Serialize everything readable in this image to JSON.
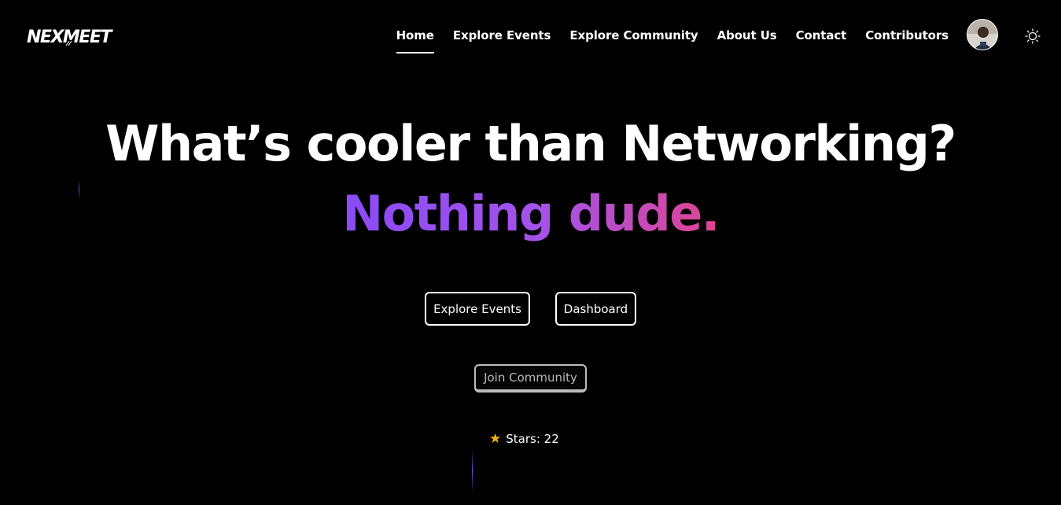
{
  "navbar": {
    "logo_text": "NEXMEET",
    "links": [
      {
        "label": "Home",
        "active": true
      },
      {
        "label": "Explore Events",
        "active": false
      },
      {
        "label": "Explore Community",
        "active": false
      },
      {
        "label": "About Us",
        "active": false
      },
      {
        "label": "Contact",
        "active": false
      },
      {
        "label": "Contributors",
        "active": false
      }
    ],
    "avatar_icon": "user-avatar",
    "theme_icon": "sun-icon"
  },
  "hero": {
    "headline": "What’s cooler than Networking?",
    "subheadline": "Nothing dude.",
    "gradient_colors": [
      "#8a4bf6",
      "#a552e8",
      "#e0448f"
    ]
  },
  "buttons": {
    "explore_events": "Explore Events",
    "dashboard": "Dashboard",
    "join_community": "Join Community"
  },
  "stars": {
    "icon": "★",
    "label": "Stars: 22"
  },
  "colors": {
    "background": "#000000",
    "text": "#ffffff",
    "star": "#f4b400"
  }
}
